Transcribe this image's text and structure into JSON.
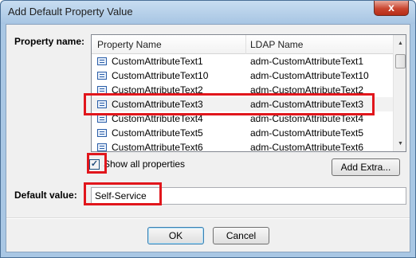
{
  "window": {
    "title": "Add Default Property Value",
    "close_glyph": "x"
  },
  "property": {
    "label": "Property name:",
    "columns": [
      "Property Name",
      "LDAP Name"
    ],
    "rows": [
      {
        "name": "CustomAttributeText1",
        "ldap": "adm-CustomAttributeText1"
      },
      {
        "name": "CustomAttributeText10",
        "ldap": "adm-CustomAttributeText10"
      },
      {
        "name": "CustomAttributeText2",
        "ldap": "adm-CustomAttributeText2"
      },
      {
        "name": "CustomAttributeText3",
        "ldap": "adm-CustomAttributeText3"
      },
      {
        "name": "CustomAttributeText4",
        "ldap": "adm-CustomAttributeText4"
      },
      {
        "name": "CustomAttributeText5",
        "ldap": "adm-CustomAttributeText5"
      },
      {
        "name": "CustomAttributeText6",
        "ldap": "adm-CustomAttributeText6"
      }
    ],
    "selected_row": 3
  },
  "show_all": {
    "label": "Show all properties",
    "checked": true,
    "check_glyph": "✓"
  },
  "add_extra_label": "Add Extra...",
  "default_value": {
    "label": "Default value:",
    "value": "Self-Service"
  },
  "buttons": {
    "ok": "OK",
    "cancel": "Cancel"
  },
  "colors": {
    "highlight": "#e1161c"
  },
  "scrollbar": {
    "up_glyph": "▲",
    "down_glyph": "▼"
  }
}
